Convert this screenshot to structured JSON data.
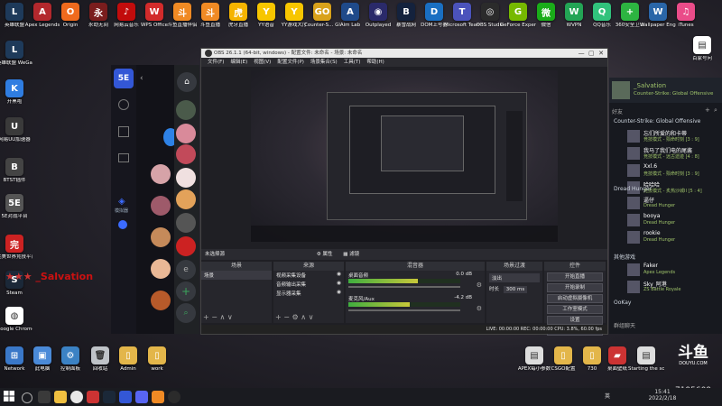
{
  "desktop_icons": [
    {
      "label": "英雄联盟",
      "color": "#1e3a5a",
      "glyph": "L"
    },
    {
      "label": "Apex Legends",
      "color": "#b3282d",
      "glyph": "A"
    },
    {
      "label": "Origin",
      "color": "#f06a1d",
      "glyph": "O"
    },
    {
      "label": "永劫无间",
      "color": "#7a1d1d",
      "glyph": "永"
    },
    {
      "label": "网易云音乐",
      "color": "#c20c0c",
      "glyph": "♪"
    },
    {
      "label": "WPS Office",
      "color": "#d22b2b",
      "glyph": "W"
    },
    {
      "label": "斗鱼直播伴侣",
      "color": "#f08a24",
      "glyph": "斗"
    },
    {
      "label": "斗鱼直播",
      "color": "#f08a24",
      "glyph": "斗"
    },
    {
      "label": "虎牙直播",
      "color": "#f5b400",
      "glyph": "虎"
    },
    {
      "label": "YY语音",
      "color": "#f7c600",
      "glyph": "Y"
    },
    {
      "label": "YY游戏大厅",
      "color": "#f7c600",
      "glyph": "Y"
    },
    {
      "label": "Counter-S... Global Off...",
      "color": "#d9a21b",
      "glyph": "GO"
    },
    {
      "label": "Aim Lab",
      "color": "#1f4a8a",
      "glyph": "A"
    },
    {
      "label": "Outplayed",
      "color": "#2a2a6a",
      "glyph": "◉"
    },
    {
      "label": "暴雪战网",
      "color": "#14223d",
      "glyph": "B"
    },
    {
      "label": "DOM上号器",
      "color": "#1a6fc2",
      "glyph": "D"
    },
    {
      "label": "Microsoft Teams",
      "color": "#4b53bc",
      "glyph": "T"
    },
    {
      "label": "OBS Studio",
      "color": "#2b2b2b",
      "glyph": "◎"
    },
    {
      "label": "GeForce Experience",
      "color": "#76b900",
      "glyph": "G"
    },
    {
      "label": "微信",
      "color": "#1aad19",
      "glyph": "微"
    },
    {
      "label": "WVPN",
      "color": "#23a455",
      "glyph": "W"
    },
    {
      "label": "QQ音乐",
      "color": "#31c27c",
      "glyph": "Q"
    },
    {
      "label": "360安全卫士",
      "color": "#2db441",
      "glyph": "+"
    },
    {
      "label": "Wallpaper Engine",
      "color": "#2a66a8",
      "glyph": "W"
    },
    {
      "label": "iTunes",
      "color": "#ea4c89",
      "glyph": "♫"
    }
  ],
  "left_icons": [
    {
      "label": "英雄联盟 WeGame版",
      "color": "#1e3a5a",
      "glyph": "L"
    },
    {
      "label": "开黑啦",
      "color": "#2f7de1",
      "glyph": "K"
    },
    {
      "label": "网易UU加速器",
      "color": "#3a3a3a",
      "glyph": "U"
    },
    {
      "label": "BTST插件",
      "color": "#444",
      "glyph": "B"
    },
    {
      "label": "5E对战平台",
      "color": "#555",
      "glyph": "5E"
    },
    {
      "label": "完美世界竞技平台",
      "color": "#c22",
      "glyph": "完"
    },
    {
      "label": "Steam",
      "color": "#1b2838",
      "glyph": "S"
    },
    {
      "label": "Google Chrome",
      "color": "#ffffff",
      "glyph": "◍"
    }
  ],
  "bottom_icons": [
    {
      "label": "Network",
      "color": "#3a78c8",
      "glyph": "⊞"
    },
    {
      "label": "此电脑",
      "color": "#4a8ad8",
      "glyph": "▣"
    },
    {
      "label": "控制面板",
      "color": "#3b82c4",
      "glyph": "⚙"
    },
    {
      "label": "回收站",
      "color": "#bfc3c8",
      "glyph": "🗑"
    },
    {
      "label": "Admin",
      "color": "#e3b64a",
      "glyph": "▯"
    },
    {
      "label": "work",
      "color": "#e3b64a",
      "glyph": "▯"
    },
    {
      "label": "APEX每小参数",
      "color": "#ddd",
      "glyph": "▤"
    },
    {
      "label": "CSGO配置",
      "color": "#e3b64a",
      "glyph": "▯"
    },
    {
      "label": "730",
      "color": "#e3b64a",
      "glyph": "▯"
    },
    {
      "label": "桌面壁纸",
      "color": "#c33",
      "glyph": "▰"
    },
    {
      "label": "Starting the school year",
      "color": "#ddd",
      "glyph": "▤"
    }
  ],
  "recycle_right": {
    "label": "百家号问",
    "color": "#fff"
  },
  "watermark": {
    "name": "_Salvation"
  },
  "obs": {
    "title": "OBS 26.1.1 (64-bit, windows) - 配置文件: 未命名 - 场景: 未命名",
    "menu": [
      "文件(F)",
      "编辑(E)",
      "视图(V)",
      "配置文件(P)",
      "场景集合(S)",
      "工具(T)",
      "帮助(H)"
    ],
    "docks": [
      "场景",
      "来源",
      "混音器",
      "场景过渡",
      "控件"
    ],
    "no_source": "未选择源",
    "props": "属性",
    "filters": "滤镜",
    "scene_item": "场景",
    "sources": [
      "视频采集设备",
      "音频输出采集",
      "显示器采集"
    ],
    "mixer": [
      {
        "name": "桌面音频",
        "db": "0.0 dB",
        "level": 0.62
      },
      {
        "name": "麦克风/Aux",
        "db": "-4.2 dB",
        "level": 0.55
      }
    ],
    "transition": {
      "type": "淡出",
      "duration_label": "时长",
      "duration": "300 ms"
    },
    "controls": [
      "开始直播",
      "开始录制",
      "启动虚拟摄像机",
      "工作室模式",
      "设置",
      "退出"
    ],
    "status": "LIVE: 00:00:00   REC: 00:00:00   CPU: 3.8%, 60.00 fps"
  },
  "fivee": {
    "logo": "5E",
    "nav": [
      "首页",
      "匹配",
      "排位",
      "商城",
      "模拟器"
    ]
  },
  "discord": {
    "home": "Discord"
  },
  "steam": {
    "user": "_Salvation",
    "playing": "Counter-Strike: Global Offensive",
    "friends_label": "好友",
    "group1_title": "Counter-Strike: Global Offensive",
    "group1": [
      {
        "name": "忘们所爱的和卡蒂",
        "status": "竞技模式 - 殒命时刻 [3 : 9]"
      },
      {
        "name": "我马了我们电的尾酱",
        "status": "竞技模式 - 远古遗迹 [4 : 8]"
      },
      {
        "name": "Xxl.6",
        "status": "竞技模式 - 殒命时刻 [3 : 9]"
      },
      {
        "name": "哈哈哈",
        "status": "竞技模式 - 炙热沙城II [5 : 4]"
      }
    ],
    "group2_title": "Dread Hunger",
    "group2": [
      {
        "name": "逼仔",
        "status": "Dread Hunger"
      },
      {
        "name": "booya",
        "status": "Dread Hunger"
      },
      {
        "name": "rookie",
        "status": "Dread Hunger"
      }
    ],
    "group3_title": "其他游戏",
    "group3": [
      {
        "name": "Faker",
        "status": "Apex Legends"
      },
      {
        "name": "Sky_阿港",
        "status": "ZS Battle Royale"
      }
    ],
    "footer": "OoKay",
    "chat": "群组聊天"
  },
  "douyu": {
    "logo": "斗鱼",
    "sub": "DOUYU.COM",
    "room": "7195609"
  },
  "taskbar": {
    "time": "15:41",
    "date": "2022/2/18",
    "lang": "英"
  }
}
